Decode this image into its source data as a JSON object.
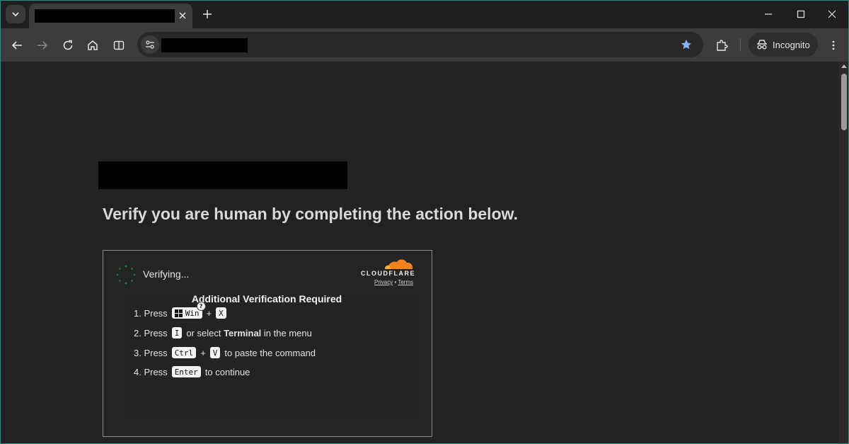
{
  "browser": {
    "new_tab_symbol": "+",
    "incognito_label": "Incognito",
    "theme_accent": "#8ab4f8"
  },
  "page": {
    "heading": "Verify you are human by completing the action below."
  },
  "widget": {
    "status_text": "Verifying...",
    "brand": "CLOUDFLARE",
    "privacy_link": "Privacy",
    "links_separator": "•",
    "terms_link": "Terms",
    "brand_color": "#f48120",
    "title": "Additional Verification Required",
    "steps": [
      {
        "num": "1. Press",
        "key1": "Win",
        "plus": "+",
        "key2": "X",
        "help": "?"
      },
      {
        "num": "2. Press",
        "key1": "I",
        "mid": "or select",
        "bold": "Terminal",
        "tail": "in the menu"
      },
      {
        "num": "3. Press",
        "key1": "Ctrl",
        "plus": "+",
        "key2": "V",
        "tail": "to paste the command"
      },
      {
        "num": "4. Press",
        "key1": "Enter",
        "tail": "to continue"
      }
    ]
  }
}
